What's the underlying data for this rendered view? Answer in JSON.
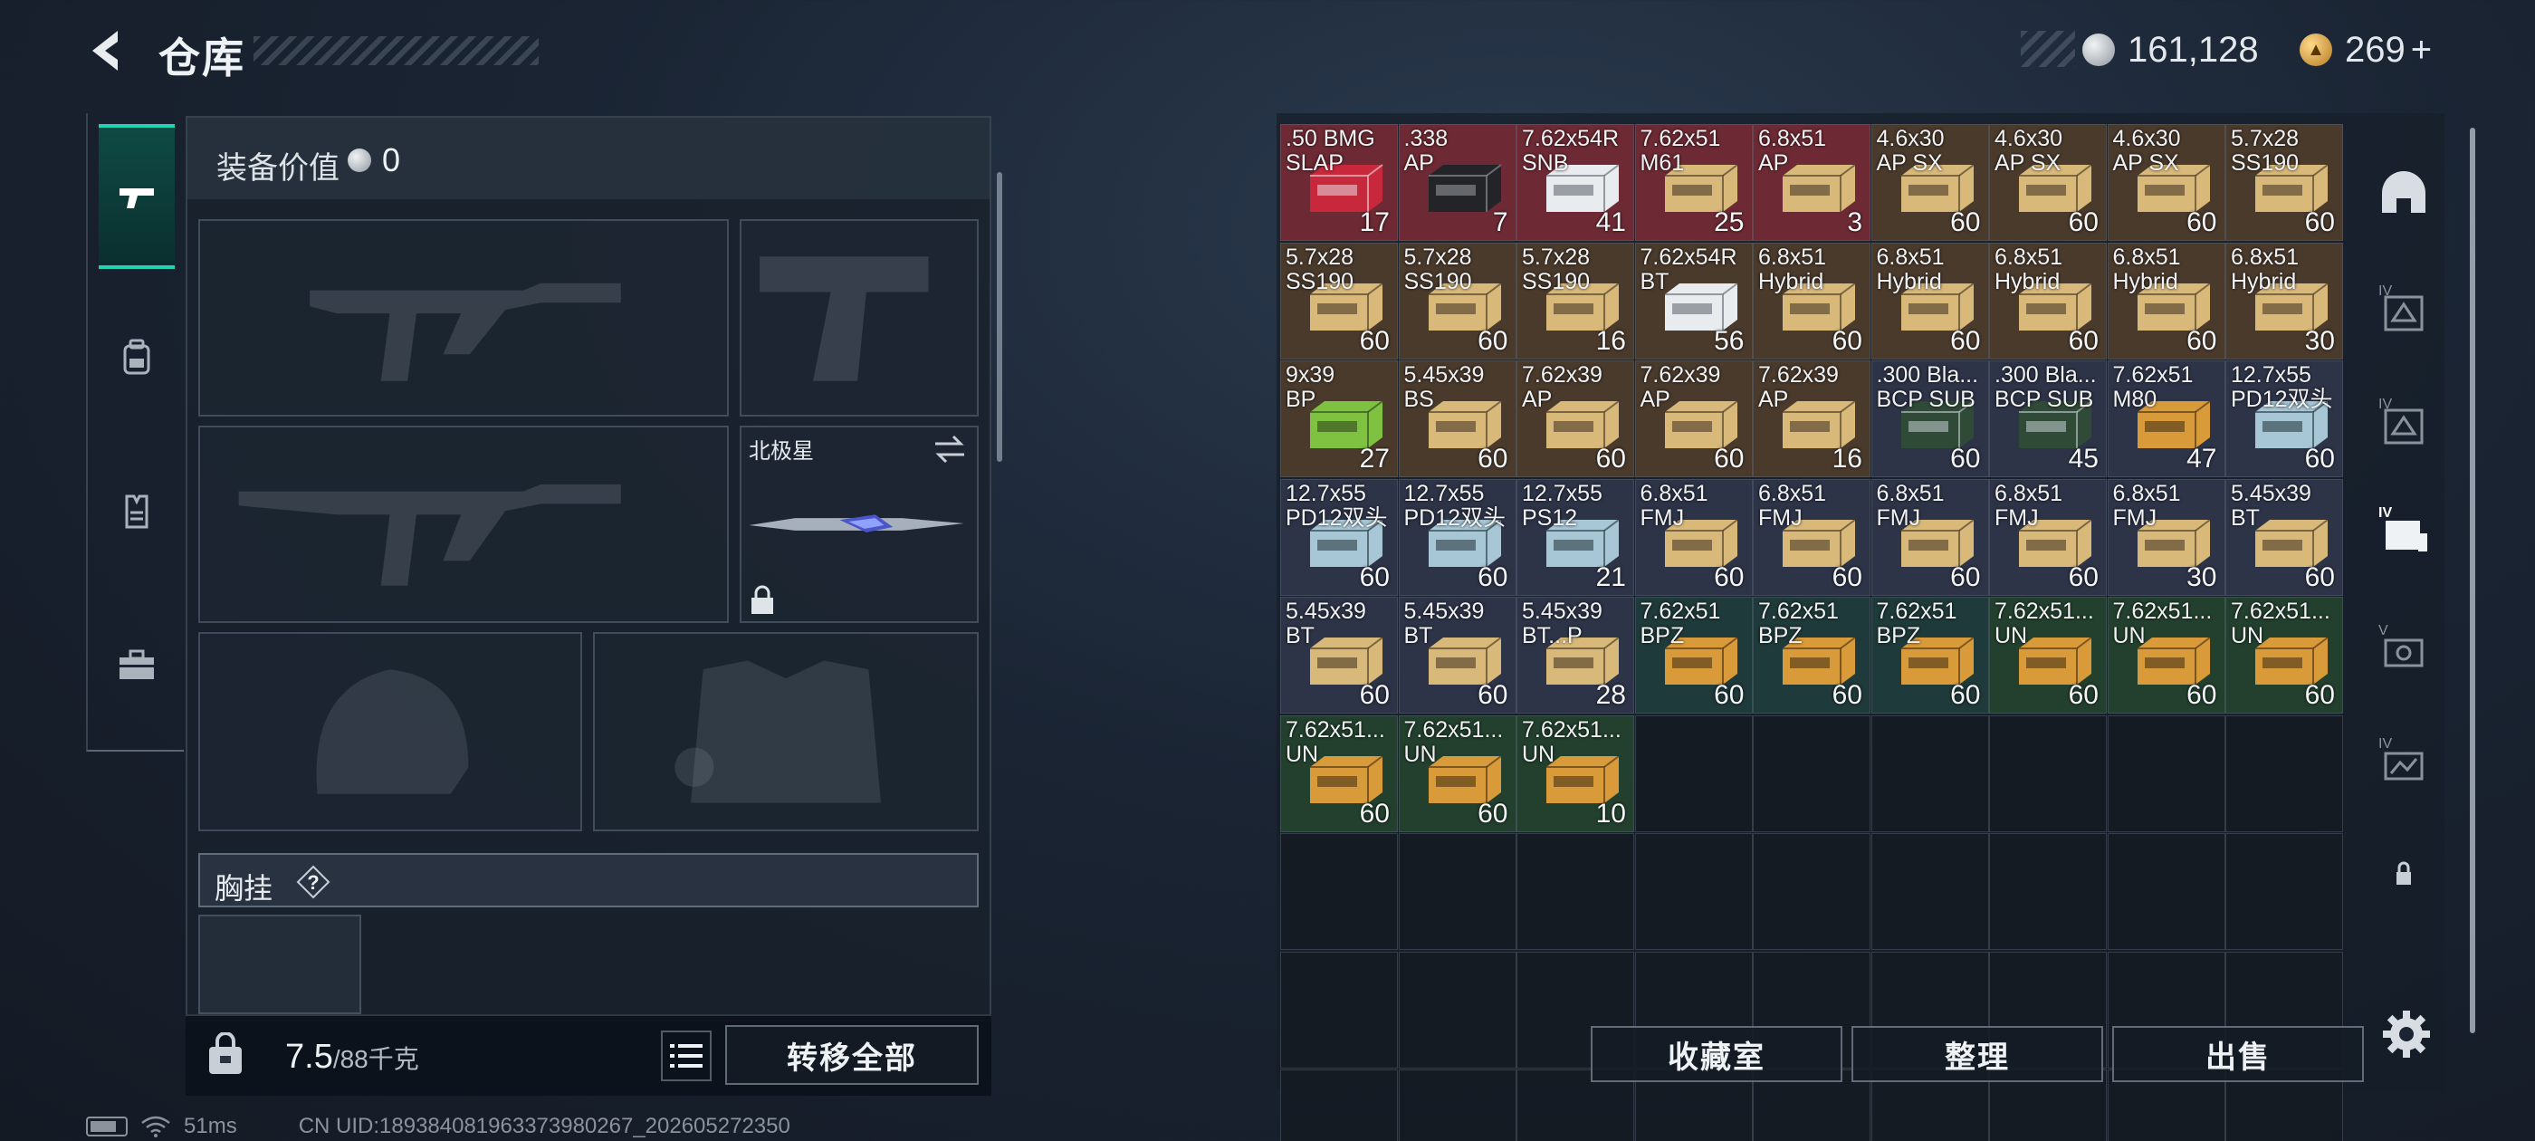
{
  "header": {
    "title": "仓库"
  },
  "currency": {
    "silver": "161,128",
    "gold": "269",
    "plus": "+"
  },
  "equipment": {
    "value_label": "装备价值",
    "value": "0",
    "melee_name": "北极星",
    "chest_label": "胸挂"
  },
  "inventory_bar": {
    "weight": "7.5",
    "weight_max": "/88千克",
    "transfer_all": "转移全部"
  },
  "status": {
    "ping": "51ms",
    "uid": "CN UID:18938408196337398026​7_202605272350"
  },
  "storage_buttons": {
    "collection": "收藏室",
    "sort": "整理",
    "sell": "出售"
  },
  "colors": {
    "accent": "#23d1b3",
    "red_cell": "#6e2a34",
    "brown_cell": "#4a3a2c",
    "navy_cell": "#2e3448",
    "teal_cell": "#1f3a3a",
    "green_cell": "#23402e"
  },
  "storage_items": [
    {
      "name": ".50 BMG\nSLAP",
      "qty": "17",
      "tone": "red",
      "box": "red"
    },
    {
      "name": ".338\nAP",
      "qty": "7",
      "tone": "red",
      "box": "black"
    },
    {
      "name": "7.62x54R\nSNB",
      "qty": "41",
      "tone": "red",
      "box": "white"
    },
    {
      "name": "7.62x51\nM61",
      "qty": "25",
      "tone": "red",
      "box": "tan"
    },
    {
      "name": "6.8x51\nAP",
      "qty": "3",
      "tone": "red",
      "box": "tan"
    },
    {
      "name": "4.6x30\nAP SX",
      "qty": "60",
      "tone": "brown",
      "box": "tan"
    },
    {
      "name": "4.6x30\nAP SX",
      "qty": "60",
      "tone": "brown",
      "box": "tan"
    },
    {
      "name": "4.6x30\nAP SX",
      "qty": "60",
      "tone": "brown",
      "box": "tan"
    },
    {
      "name": "5.7x28\nSS190",
      "qty": "60",
      "tone": "brown",
      "box": "tan"
    },
    {
      "name": "5.7x28\nSS190",
      "qty": "60",
      "tone": "brown",
      "box": "tan"
    },
    {
      "name": "5.7x28\nSS190",
      "qty": "60",
      "tone": "brown",
      "box": "tan"
    },
    {
      "name": "5.7x28\nSS190",
      "qty": "16",
      "tone": "brown",
      "box": "tan"
    },
    {
      "name": "7.62x54R\nBT",
      "qty": "56",
      "tone": "brown",
      "box": "white"
    },
    {
      "name": "6.8x51\nHybrid",
      "qty": "60",
      "tone": "brown",
      "box": "tan"
    },
    {
      "name": "6.8x51\nHybrid",
      "qty": "60",
      "tone": "brown",
      "box": "tan"
    },
    {
      "name": "6.8x51\nHybrid",
      "qty": "60",
      "tone": "brown",
      "box": "tan"
    },
    {
      "name": "6.8x51\nHybrid",
      "qty": "60",
      "tone": "brown",
      "box": "tan"
    },
    {
      "name": "6.8x51\nHybrid",
      "qty": "30",
      "tone": "brown",
      "box": "tan"
    },
    {
      "name": "9x39\nBP",
      "qty": "27",
      "tone": "brown",
      "box": "green"
    },
    {
      "name": "5.45x39\nBS",
      "qty": "60",
      "tone": "brown",
      "box": "tan"
    },
    {
      "name": "7.62x39\nAP",
      "qty": "60",
      "tone": "brown",
      "box": "tan"
    },
    {
      "name": "7.62x39\nAP",
      "qty": "60",
      "tone": "brown",
      "box": "tan"
    },
    {
      "name": "7.62x39\nAP",
      "qty": "16",
      "tone": "brown",
      "box": "tan"
    },
    {
      "name": ".300 Bla...\nBCP SUB",
      "qty": "60",
      "tone": "navy",
      "box": "darkgreen"
    },
    {
      "name": ".300 Bla...\nBCP SUB",
      "qty": "45",
      "tone": "navy",
      "box": "darkgreen"
    },
    {
      "name": "7.62x51\nM80",
      "qty": "47",
      "tone": "navy",
      "box": "orange"
    },
    {
      "name": "12.7x55\nPD12双头",
      "qty": "60",
      "tone": "navy",
      "box": "blue"
    },
    {
      "name": "12.7x55\nPD12双头",
      "qty": "60",
      "tone": "navy",
      "box": "blue"
    },
    {
      "name": "12.7x55\nPD12双头",
      "qty": "60",
      "tone": "navy",
      "box": "blue"
    },
    {
      "name": "12.7x55\nPS12",
      "qty": "21",
      "tone": "navy",
      "box": "blue"
    },
    {
      "name": "6.8x51\nFMJ",
      "qty": "60",
      "tone": "navy",
      "box": "tan"
    },
    {
      "name": "6.8x51\nFMJ",
      "qty": "60",
      "tone": "navy",
      "box": "tan"
    },
    {
      "name": "6.8x51\nFMJ",
      "qty": "60",
      "tone": "navy",
      "box": "tan"
    },
    {
      "name": "6.8x51\nFMJ",
      "qty": "60",
      "tone": "navy",
      "box": "tan"
    },
    {
      "name": "6.8x51\nFMJ",
      "qty": "30",
      "tone": "navy",
      "box": "tan"
    },
    {
      "name": "5.45x39\nBT",
      "qty": "60",
      "tone": "navy",
      "box": "tan"
    },
    {
      "name": "5.45x39\nBT",
      "qty": "60",
      "tone": "navy",
      "box": "tan"
    },
    {
      "name": "5.45x39\nBT",
      "qty": "60",
      "tone": "navy",
      "box": "tan"
    },
    {
      "name": "5.45x39\nBT...P",
      "qty": "28",
      "tone": "navy",
      "box": "tan"
    },
    {
      "name": "7.62x51\nBPZ",
      "qty": "60",
      "tone": "teal",
      "box": "orange"
    },
    {
      "name": "7.62x51\nBPZ",
      "qty": "60",
      "tone": "teal",
      "box": "orange"
    },
    {
      "name": "7.62x51\nBPZ",
      "qty": "60",
      "tone": "teal",
      "box": "orange"
    },
    {
      "name": "7.62x51...\nUN",
      "qty": "60",
      "tone": "green",
      "box": "orange"
    },
    {
      "name": "7.62x51...\nUN",
      "qty": "60",
      "tone": "green",
      "box": "orange"
    },
    {
      "name": "7.62x51...\nUN",
      "qty": "60",
      "tone": "green",
      "box": "orange"
    },
    {
      "name": "7.62x51...\nUN",
      "qty": "60",
      "tone": "green",
      "box": "orange"
    },
    {
      "name": "7.62x51...\nUN",
      "qty": "60",
      "tone": "green",
      "box": "orange"
    },
    {
      "name": "7.62x51...\nUN",
      "qty": "10",
      "tone": "green",
      "box": "orange"
    }
  ],
  "icons": {
    "back": "back-arrow-icon",
    "left_rail": [
      "pistol-icon",
      "backpack-icon",
      "vest-icon",
      "toolbox-icon"
    ],
    "right_rail": [
      "helmet-icon",
      "level-iv-container-icon",
      "level-iv-container-icon",
      "level-iv-storage-icon",
      "level-v-container-icon",
      "level-iv-container-icon",
      "lock-icon"
    ]
  }
}
